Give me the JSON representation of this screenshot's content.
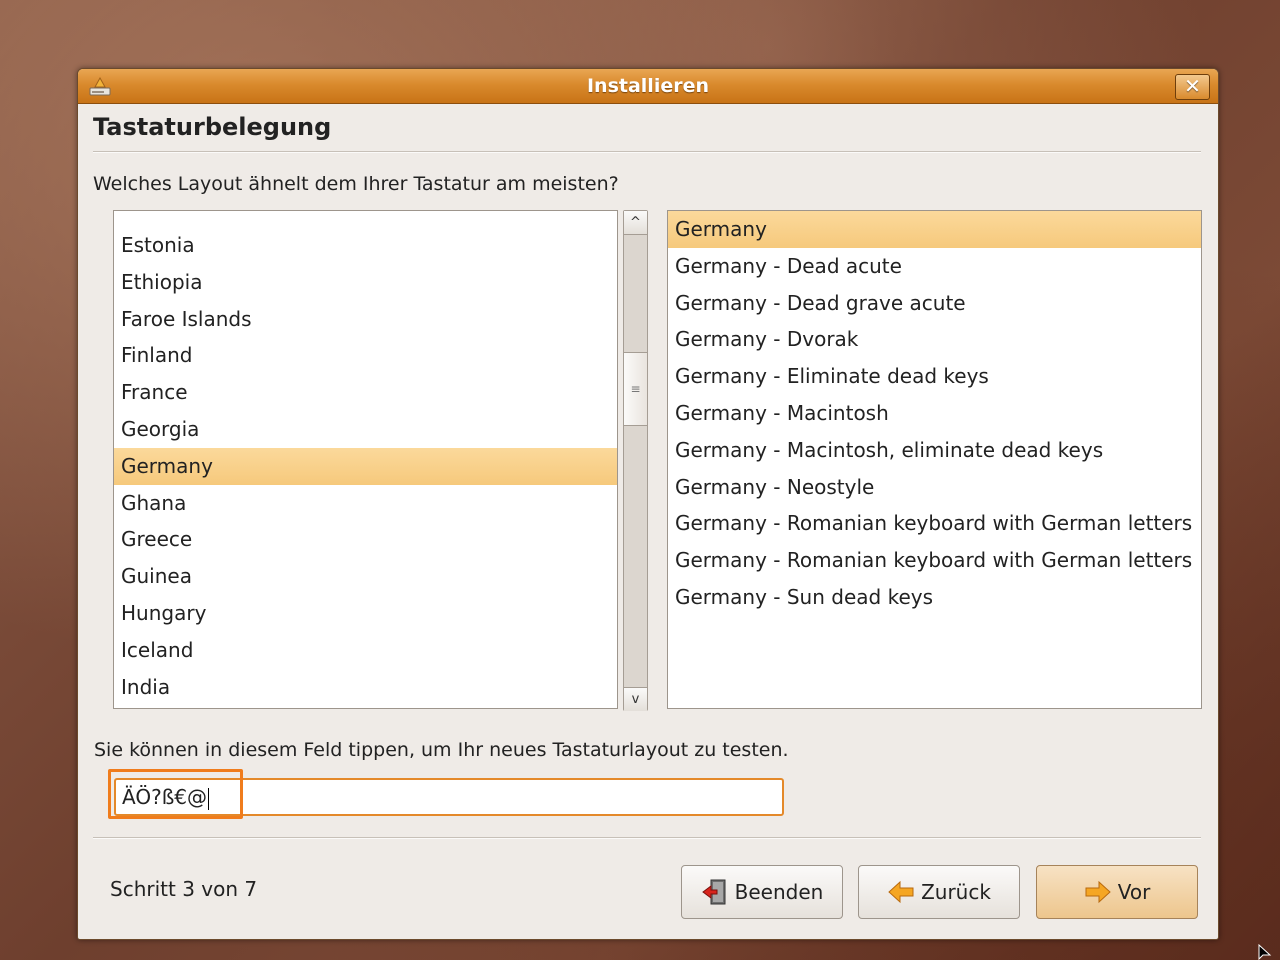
{
  "window": {
    "title": "Installieren",
    "close_symbol": "✕",
    "accent_color": "#d98a2d"
  },
  "page": {
    "heading": "Tastaturbelegung",
    "question": "Welches Layout ähnelt dem Ihrer Tastatur am meisten?"
  },
  "countries": {
    "items": [
      "Estonia",
      "Ethiopia",
      "Faroe Islands",
      "Finland",
      "France",
      "Georgia",
      "Germany",
      "Ghana",
      "Greece",
      "Guinea",
      "Hungary",
      "Iceland",
      "India"
    ],
    "selected": "Germany",
    "scroll_up_symbol": "^",
    "scroll_down_symbol": "v",
    "scroll_thumb_symbol": "≡"
  },
  "variants": {
    "items": [
      "Germany",
      "Germany - Dead acute",
      "Germany - Dead grave acute",
      "Germany - Dvorak",
      "Germany - Eliminate dead keys",
      "Germany - Macintosh",
      "Germany - Macintosh, eliminate dead keys",
      "Germany - Neostyle",
      "Germany - Romanian keyboard with German letters",
      "Germany - Romanian keyboard with German letters",
      "Germany - Sun dead keys"
    ],
    "selected": "Germany"
  },
  "test": {
    "hint": "Sie können in diesem Feld tippen, um Ihr neues Tastaturlayout zu testen.",
    "value": "ÄÖ?ß€@"
  },
  "footer": {
    "step": "Schritt 3 von 7",
    "quit_label": "Beenden",
    "back_label": "Zurück",
    "forward_label": "Vor"
  }
}
